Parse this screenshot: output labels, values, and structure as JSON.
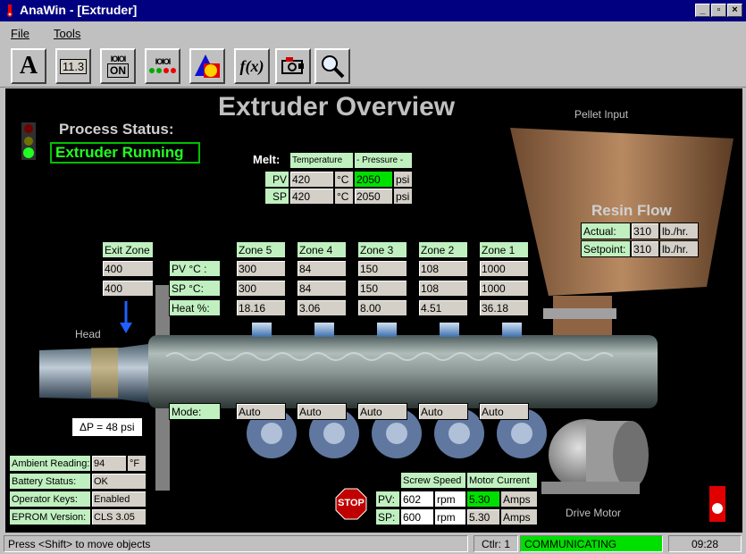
{
  "window": {
    "title": "AnaWin - [Extruder]"
  },
  "menu": {
    "file": "File",
    "tools": "Tools"
  },
  "toolbar": {
    "text_tool": "A",
    "numeric_tool": "11.3",
    "onoff_tool": "ON",
    "bits_top": "IOIOI",
    "bits_top2": "IOIOI",
    "fx_tool": "f(x)"
  },
  "overview": {
    "title": "Extruder Overview",
    "process_status_label": "Process Status:",
    "process_status_value": "Extruder Running",
    "pellet_input": "Pellet Input",
    "head": "Head",
    "drive_motor": "Drive Motor",
    "delta_p": "ΔP = 48 psi"
  },
  "melt": {
    "label": "Melt:",
    "temperature_header": "Temperature",
    "pressure_header": "- Pressure -",
    "rows": [
      {
        "label": "PV",
        "temp": "420",
        "temp_unit": "°C",
        "pressure": "2050",
        "pressure_unit": "psi"
      },
      {
        "label": "SP",
        "temp": "420",
        "temp_unit": "°C",
        "pressure": "2050",
        "pressure_unit": "psi"
      }
    ]
  },
  "resin_flow": {
    "title": "Resin Flow",
    "actual_label": "Actual:",
    "actual": "310",
    "actual_unit": "lb./hr.",
    "setpoint_label": "Setpoint:",
    "setpoint": "310",
    "setpoint_unit": "lb./hr."
  },
  "zones": {
    "exit_zone": {
      "header": "Exit Zone",
      "pv": "400",
      "sp": "400"
    },
    "row_labels": {
      "pv": "PV  °C :",
      "sp": "SP  °C:",
      "heat": "Heat %:",
      "mode": "Mode:"
    },
    "items": [
      {
        "header": "Zone 5",
        "pv": "300",
        "sp": "300",
        "heat": "18.16",
        "mode": "Auto"
      },
      {
        "header": "Zone 4",
        "pv": "84",
        "sp": "84",
        "heat": "3.06",
        "mode": "Auto"
      },
      {
        "header": "Zone 3",
        "pv": "150",
        "sp": "150",
        "heat": "8.00",
        "mode": "Auto"
      },
      {
        "header": "Zone 2",
        "pv": "108",
        "sp": "108",
        "heat": "4.51",
        "mode": "Auto"
      },
      {
        "header": "Zone 1",
        "pv": "1000",
        "sp": "1000",
        "heat": "36.18",
        "mode": "Auto"
      }
    ]
  },
  "status_panel": {
    "rows": [
      {
        "label": "Ambient Reading:",
        "value": "94",
        "unit": "°F"
      },
      {
        "label": "Battery Status:",
        "value": "OK"
      },
      {
        "label": "Operator Keys:",
        "value": "Enabled"
      },
      {
        "label": "EPROM Version:",
        "value": "CLS 3.05"
      }
    ]
  },
  "screw": {
    "stop_label": "STOP",
    "speed_header": "Screw Speed",
    "current_header": "Motor Current",
    "pv_label": "PV:",
    "pv_speed": "602",
    "pv_speed_unit": "rpm",
    "pv_current": "5.30",
    "pv_current_unit": "Amps",
    "sp_label": "SP:",
    "sp_speed": "600",
    "sp_speed_unit": "rpm",
    "sp_current": "5.30",
    "sp_current_unit": "Amps"
  },
  "statusbar": {
    "hint": "Press <Shift> to move objects",
    "ctlr": "Ctlr: 1",
    "comm": "COMMUNICATING",
    "time": "09:28"
  },
  "colors": {
    "title_bar": "#000080",
    "canvas": "#000000",
    "ok_green": "#00e000",
    "label_green": "#c0f0c0"
  }
}
